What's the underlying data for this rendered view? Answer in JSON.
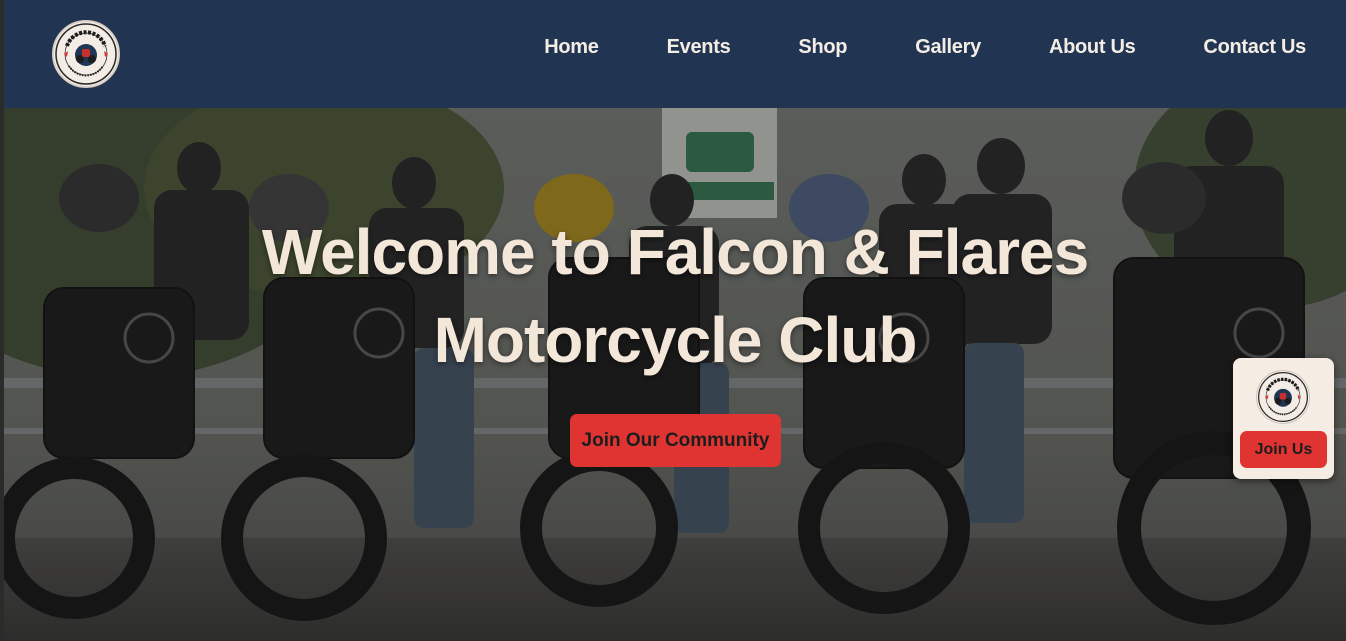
{
  "brand": {
    "logo_icon": "falcon-and-flares-logo-icon",
    "logo_text": "FALCON & FLARES",
    "logo_subtext": "motorcycle club"
  },
  "nav": {
    "items": [
      {
        "label": "Home"
      },
      {
        "label": "Events"
      },
      {
        "label": "Shop"
      },
      {
        "label": "Gallery"
      },
      {
        "label": "About Us"
      },
      {
        "label": "Contact Us"
      }
    ]
  },
  "hero": {
    "title_line1": "Welcome to Falcon & Flares",
    "title_line2": "Motorcycle Club",
    "cta_label": "Join Our Community",
    "background_image": "group-of-riders-with-motorcycles-photo"
  },
  "floating_join": {
    "button_label": "Join Us",
    "logo_icon": "falcon-and-flares-logo-icon"
  },
  "colors": {
    "nav_bg": "#213552",
    "accent_red": "#e03432",
    "cream_text": "#f3e7da"
  }
}
